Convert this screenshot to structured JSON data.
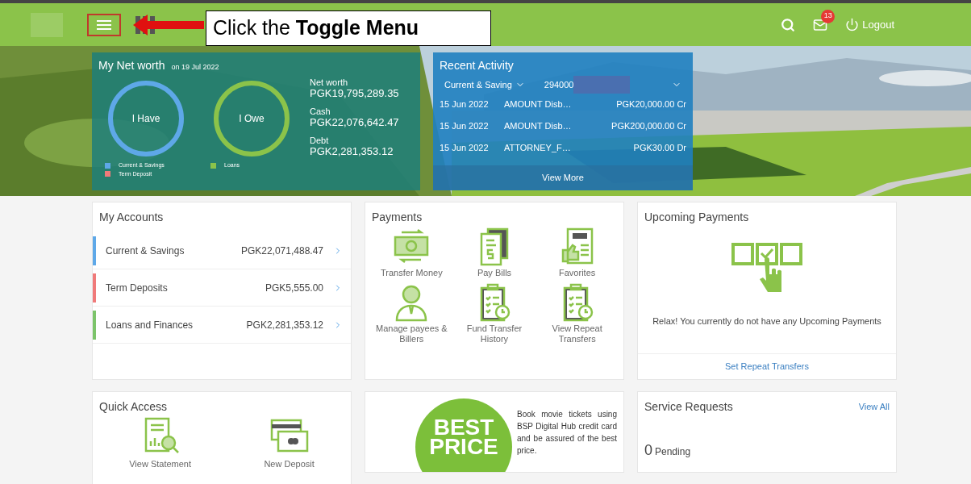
{
  "header": {
    "tutorial_callout": {
      "text": "Click the **Toggle Menu**"
    },
    "notification_count": "13",
    "logout": "Logout"
  },
  "net_worth": {
    "title": "My Net worth",
    "date": "on 19 Jul 2022",
    "rings": [
      {
        "label": "I Have",
        "color": "#5ea8e8"
      },
      {
        "label": "I Owe",
        "color": "#8bc34a"
      }
    ],
    "legend_have": [
      {
        "label": "Current & Savings",
        "color": "#5ea8e8"
      },
      {
        "label": "Term Deposit",
        "color": "#f07a7a"
      }
    ],
    "legend_owe": [
      {
        "label": "Loans",
        "color": "#8bc34a"
      }
    ],
    "figures": [
      {
        "label": "Net worth",
        "value": "PGK19,795,289.35"
      },
      {
        "label": "Cash",
        "value": "PGK22,076,642.47"
      },
      {
        "label": "Debt",
        "value": "PGK2,281,353.12"
      }
    ]
  },
  "recent_activity": {
    "title": "Recent Activity",
    "account_type": "Current & Saving",
    "account_number": "294000",
    "rows": [
      {
        "date": "15 Jun 2022",
        "description": "AMOUNT Disb…",
        "amount": "PGK20,000.00 Cr"
      },
      {
        "date": "15 Jun 2022",
        "description": "AMOUNT Disb…",
        "amount": "PGK200,000.00 Cr"
      },
      {
        "date": "15 Jun 2022",
        "description": "ATTORNEY_F…",
        "amount": "PGK30.00 Dr"
      }
    ],
    "view_more": "View More"
  },
  "my_accounts": {
    "title": "My Accounts",
    "rows": [
      {
        "name": "Current & Savings",
        "amount": "PGK22,071,488.47",
        "color": "#5ea8e8"
      },
      {
        "name": "Term Deposits",
        "amount": "PGK5,555.00",
        "color": "#f07a7a"
      },
      {
        "name": "Loans and Finances",
        "amount": "PGK2,281,353.12",
        "color": "#7cc46a"
      }
    ]
  },
  "payments": {
    "title": "Payments",
    "items": [
      {
        "kind": "transfer",
        "label": "Transfer Money"
      },
      {
        "kind": "bill",
        "label": "Pay Bills"
      },
      {
        "kind": "favorite",
        "label": "Favorites"
      },
      {
        "kind": "payee",
        "label": "Manage payees & Billers"
      },
      {
        "kind": "history",
        "label": "Fund Transfer History"
      },
      {
        "kind": "repeat",
        "label": "View Repeat Transfers"
      }
    ]
  },
  "upcoming_payments": {
    "title": "Upcoming Payments",
    "message": "Relax! You currently do not have any Upcoming Payments",
    "action": "Set Repeat Transfers"
  },
  "quick_access": {
    "title": "Quick Access",
    "items": [
      {
        "kind": "statement",
        "label": "View Statement"
      },
      {
        "kind": "deposit",
        "label": "New Deposit"
      }
    ]
  },
  "promo": {
    "badge_lines": [
      "BEST",
      "PRICE"
    ],
    "text": "Book movie tickets using BSP Digital Hub credit card and be assured of the best price."
  },
  "service_requests": {
    "title": "Service Requests",
    "view_all": "View All",
    "count": "0",
    "count_label": "Pending"
  }
}
